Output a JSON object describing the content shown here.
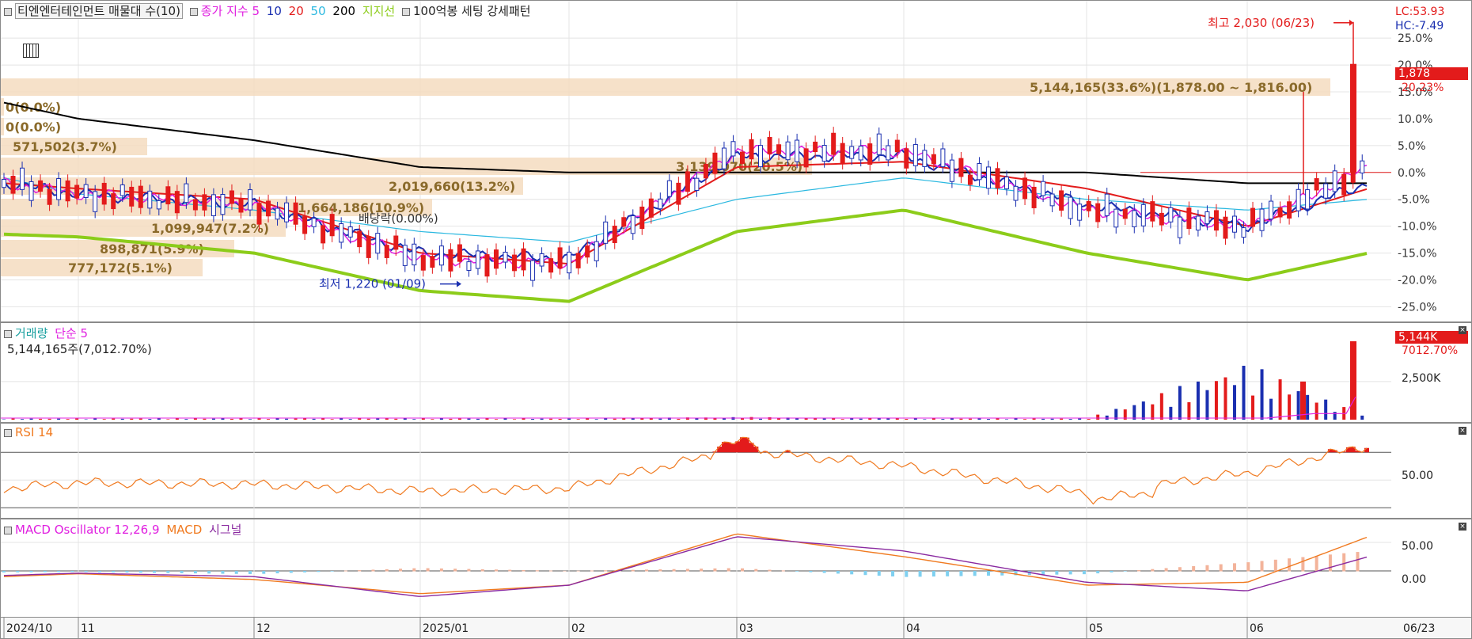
{
  "legend": {
    "title": "티엔엔터테인먼트 매물대 수(10)",
    "ma_label": "종가 지수 5",
    "ma_10": "10",
    "ma_20": "20",
    "ma_50": "50",
    "ma_200": "200",
    "support": "지지선",
    "setting": "100억봉 세팅 강세패턴"
  },
  "price_panel": {
    "lc": "LC:53.93",
    "hc": "HC:-7.49",
    "current_price": "1,878",
    "current_pct": "20.23%",
    "high_label": "최고 2,030 (06/23)",
    "low_label": "최저 1,220 (01/09)",
    "dividend_label": "배당락(0.00%)",
    "y_ticks": [
      "25.0%",
      "20.0%",
      "15.0%",
      "10.0%",
      "5.0%",
      "0.0%",
      "-5.0%",
      "-10.0%",
      "-15.0%",
      "-20.0%",
      "-25.0%"
    ],
    "volume_profile": [
      {
        "label": "5,144,165(33.6%)(1,878.00 ~ 1,816.00)",
        "value_pct": 33.6
      },
      {
        "label": "0(0.0%)",
        "value_pct": 0.0
      },
      {
        "label": "0(0.0%)",
        "value_pct": 0.0
      },
      {
        "label": "571,502(3.7%)",
        "value_pct": 3.7
      },
      {
        "label": "3,139,070(20.5%)",
        "value_pct": 20.5
      },
      {
        "label": "2,019,660(13.2%)",
        "value_pct": 13.2
      },
      {
        "label": "1,664,186(10.9%)",
        "value_pct": 10.9
      },
      {
        "label": "1,099,947(7.2%)",
        "value_pct": 7.2
      },
      {
        "label": "898,871(5.9%)",
        "value_pct": 5.9
      },
      {
        "label": "777,172(5.1%)",
        "value_pct": 5.1
      }
    ]
  },
  "volume_panel": {
    "title": "거래량",
    "ma_label": "단순 5",
    "readout": "5,144,165주(7,012.70%)",
    "current_value": "5,144K",
    "current_pct": "7012.70%",
    "y_tick": "2,500K"
  },
  "rsi_panel": {
    "title": "RSI 14",
    "y_tick": "50.00"
  },
  "macd_panel": {
    "title": "MACD Oscillator 12,26,9",
    "macd_label": "MACD",
    "signal_label": "시그널",
    "y_ticks": [
      "50.00",
      "0.00"
    ]
  },
  "x_axis": {
    "labels": [
      "2024/10",
      "11",
      "12",
      "2025/01",
      "02",
      "03",
      "04",
      "05",
      "06"
    ],
    "end_label": "06/23"
  },
  "colors": {
    "up": "#e31b1b",
    "down": "#1a2fb0",
    "ma5": "#e020e0",
    "ma10": "#1a2fb0",
    "ma20": "#e31b1b",
    "ma50": "#2ab8e0",
    "ma200": "#000000",
    "support": "#8ccc1a",
    "profile": "#f5dcc0",
    "rsi": "#f07a20",
    "macd": "#f07a20",
    "signal": "#8a2aa0",
    "osc_pos": "#f3b39a",
    "osc_neg": "#7fd0f0"
  },
  "chart_data": [
    {
      "type": "line",
      "title": "티엔엔터테인먼트",
      "x": [
        "2024/10",
        "11",
        "12",
        "2025/01",
        "02",
        "03",
        "04",
        "05",
        "06",
        "06/23"
      ],
      "series": [
        {
          "name": "200",
          "values": [
            13,
            10,
            6,
            1,
            0,
            0,
            0,
            0,
            -2,
            -2
          ]
        },
        {
          "name": "지지선",
          "values": [
            -11.5,
            -12,
            -15,
            -22,
            -24,
            -11,
            -7,
            -15,
            -20,
            -15
          ]
        },
        {
          "name": "50",
          "values": [
            -1,
            -4,
            -7,
            -11,
            -13,
            -5,
            -1,
            -5,
            -7,
            -5
          ]
        },
        {
          "name": "20",
          "values": [
            -2,
            -3,
            -5,
            -15,
            -17,
            1,
            2,
            -3,
            -10,
            -3
          ]
        },
        {
          "name": "10",
          "values": [
            -2,
            -4,
            -6,
            -15,
            -16,
            3,
            3,
            -6,
            -10,
            -2
          ]
        },
        {
          "name": "5",
          "values": [
            -2,
            -4,
            -6,
            -16,
            -17,
            4,
            4,
            -7,
            -10,
            1
          ]
        }
      ],
      "high": {
        "value": 2030,
        "date": "06/23"
      },
      "low": {
        "value": 1220,
        "date": "01/09"
      },
      "ylim": [
        -27,
        29
      ]
    },
    {
      "type": "bar",
      "title": "거래량",
      "x": [
        "2024/10",
        "11",
        "12",
        "2025/01",
        "02",
        "03",
        "04",
        "05",
        "06",
        "06/23"
      ],
      "values": [
        50,
        50,
        60,
        60,
        50,
        120,
        60,
        50,
        2500,
        5144
      ],
      "unit": "K"
    },
    {
      "type": "line",
      "title": "RSI 14",
      "x": [
        "2024/10",
        "11",
        "12",
        "2025/01",
        "02",
        "03",
        "04",
        "05",
        "06",
        "06/23"
      ],
      "values": [
        44,
        48,
        47,
        42,
        44,
        72,
        60,
        40,
        55,
        75
      ]
    },
    {
      "type": "line",
      "title": "MACD Oscillator 12,26,9",
      "x": [
        "2024/10",
        "11",
        "12",
        "2025/01",
        "02",
        "03",
        "04",
        "05",
        "06",
        "06/23"
      ],
      "series": [
        {
          "name": "MACD",
          "values": [
            -10,
            -5,
            -15,
            -40,
            -25,
            65,
            25,
            -25,
            -20,
            60
          ]
        },
        {
          "name": "시그널",
          "values": [
            -8,
            -4,
            -10,
            -45,
            -25,
            60,
            35,
            -20,
            -35,
            25
          ]
        }
      ]
    }
  ]
}
